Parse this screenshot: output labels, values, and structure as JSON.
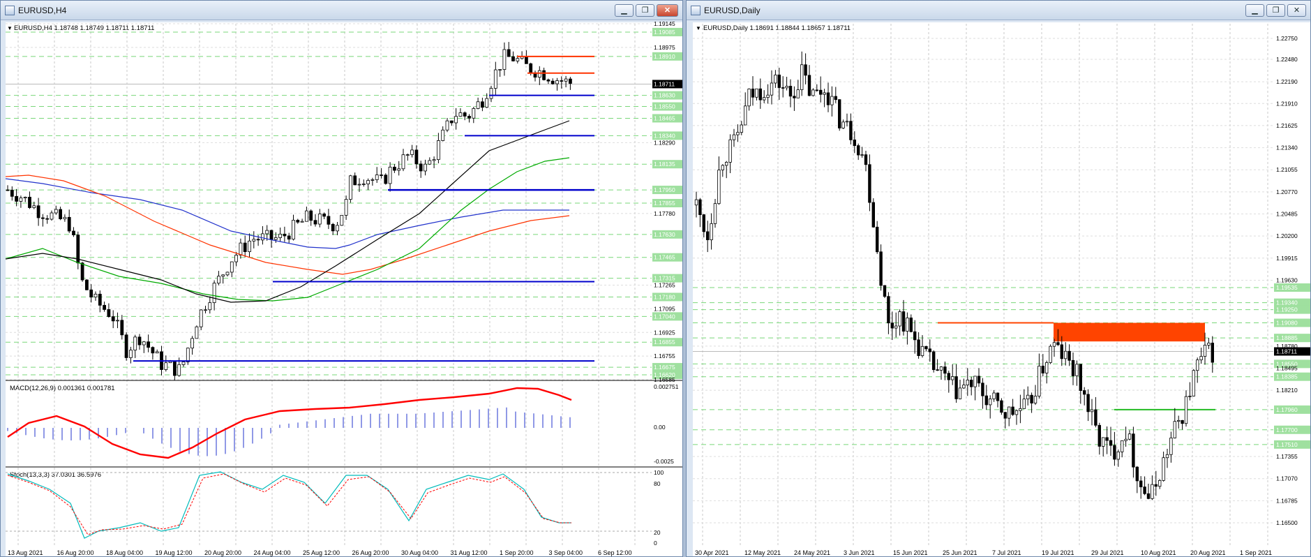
{
  "left_window": {
    "title": "EURUSD,H4",
    "chart_header": "EURUSD,H4  1.18748 1.18749 1.18711 1.18711",
    "price_labels": [
      {
        "v": "1.19145",
        "tag": false
      },
      {
        "v": "1.19085",
        "tag": true
      },
      {
        "v": "1.18975",
        "tag": false
      },
      {
        "v": "1.18910",
        "tag": true
      },
      {
        "v": "1.18711",
        "tag": "cur"
      },
      {
        "v": "1.18630",
        "tag": true
      },
      {
        "v": "1.18550",
        "tag": true
      },
      {
        "v": "1.18465",
        "tag": true
      },
      {
        "v": "1.18340",
        "tag": true
      },
      {
        "v": "1.18290",
        "tag": false
      },
      {
        "v": "1.18135",
        "tag": true
      },
      {
        "v": "1.17950",
        "tag": true
      },
      {
        "v": "1.17855",
        "tag": true
      },
      {
        "v": "1.17780",
        "tag": false
      },
      {
        "v": "1.17630",
        "tag": true
      },
      {
        "v": "1.17465",
        "tag": true
      },
      {
        "v": "1.17315",
        "tag": true
      },
      {
        "v": "1.17265",
        "tag": false
      },
      {
        "v": "1.17180",
        "tag": true
      },
      {
        "v": "1.17095",
        "tag": false
      },
      {
        "v": "1.17040",
        "tag": true
      },
      {
        "v": "1.16925",
        "tag": false
      },
      {
        "v": "1.16855",
        "tag": true
      },
      {
        "v": "1.16755",
        "tag": false
      },
      {
        "v": "1.16675",
        "tag": true
      },
      {
        "v": "1.16620",
        "tag": true
      },
      {
        "v": "1.16585",
        "tag": false
      }
    ],
    "time_labels": [
      "13 Aug 2021",
      "16 Aug 20:00",
      "18 Aug 04:00",
      "19 Aug 12:00",
      "20 Aug 20:00",
      "24 Aug 04:00",
      "25 Aug 12:00",
      "26 Aug 20:00",
      "30 Aug 04:00",
      "31 Aug 12:00",
      "1 Sep 20:00",
      "3 Sep 04:00",
      "6 Sep 12:00"
    ],
    "macd_label": "MACD(12,26,9) 0.001361 0.001781",
    "macd_ticks": [
      "0.002751",
      "0.00",
      "-0.0025"
    ],
    "stoch_label": "Stoch(13,3,3) 37.0301 36.5976",
    "stoch_ticks": [
      "100",
      "80",
      "20",
      "0"
    ],
    "colors": {
      "support": "#0000cc",
      "resistance": "#ff3300",
      "ma_black": "#000000",
      "ma_green": "#00aa00",
      "ma_red": "#ff3300",
      "ma_blue": "#2233cc"
    }
  },
  "right_window": {
    "title": "EURUSD,Daily",
    "chart_header": "EURUSD,Daily  1.18691 1.18844 1.18657 1.18711",
    "price_labels": [
      {
        "v": "1.22750",
        "tag": false
      },
      {
        "v": "1.22480",
        "tag": false
      },
      {
        "v": "1.22190",
        "tag": false
      },
      {
        "v": "1.21910",
        "tag": false
      },
      {
        "v": "1.21625",
        "tag": false
      },
      {
        "v": "1.21340",
        "tag": false
      },
      {
        "v": "1.21055",
        "tag": false
      },
      {
        "v": "1.20770",
        "tag": false
      },
      {
        "v": "1.20485",
        "tag": false
      },
      {
        "v": "1.20200",
        "tag": false
      },
      {
        "v": "1.19915",
        "tag": false
      },
      {
        "v": "1.19630",
        "tag": false
      },
      {
        "v": "1.19535",
        "tag": true
      },
      {
        "v": "1.19340",
        "tag": true
      },
      {
        "v": "1.19250",
        "tag": true
      },
      {
        "v": "1.19080",
        "tag": true
      },
      {
        "v": "1.18885",
        "tag": true
      },
      {
        "v": "1.18780",
        "tag": false
      },
      {
        "v": "1.18711",
        "tag": "cur"
      },
      {
        "v": "1.18550",
        "tag": true
      },
      {
        "v": "1.18495",
        "tag": false
      },
      {
        "v": "1.18385",
        "tag": true
      },
      {
        "v": "1.18210",
        "tag": false
      },
      {
        "v": "1.17960",
        "tag": true
      },
      {
        "v": "1.17700",
        "tag": true
      },
      {
        "v": "1.17510",
        "tag": true
      },
      {
        "v": "1.17355",
        "tag": false
      },
      {
        "v": "1.17070",
        "tag": false
      },
      {
        "v": "1.16785",
        "tag": false
      },
      {
        "v": "1.16500",
        "tag": false
      }
    ],
    "time_labels": [
      "30 Apr 2021",
      "12 May 2021",
      "24 May 2021",
      "3 Jun 2021",
      "15 Jun 2021",
      "25 Jun 2021",
      "7 Jul 2021",
      "19 Jul 2021",
      "29 Jul 2021",
      "10 Aug 2021",
      "20 Aug 2021",
      "1 Sep 2021"
    ],
    "colors": {
      "zone": "#ff4400",
      "support": "#22bb22"
    }
  }
}
